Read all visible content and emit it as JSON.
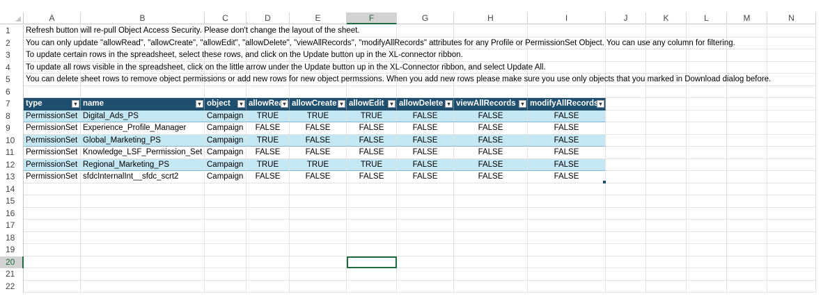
{
  "columns": [
    "A",
    "B",
    "C",
    "D",
    "E",
    "F",
    "G",
    "H",
    "I",
    "J",
    "K",
    "L",
    "M",
    "N"
  ],
  "row_numbers": [
    "1",
    "2",
    "3",
    "4",
    "5",
    "6",
    "7",
    "8",
    "9",
    "10",
    "11",
    "12",
    "13",
    "14",
    "15",
    "16",
    "17",
    "18",
    "19",
    "20",
    "21",
    "22"
  ],
  "selected_cell": "F20",
  "notes": [
    "Refresh button will re-pull Object Access Security. Please don't change the layout of the sheet.",
    "You can only update \"allowRead\", \"allowCreate\", \"allowEdit\", \"allowDelete\", \"viewAllRecords\", \"modifyAllRecords\" attributes for any Profile or PermissionSet Object. You can use any column for filtering.",
    "To update certain rows in the spreadsheet, select these rows, and click on the Update button up in the XL-connector ribbon.",
    "To update all rows visible in the spreadsheet, click on the little arrow under the Update button up in the XL-Connector ribbon, and select Update All.",
    "You can delete sheet rows to remove object permissions or add new rows for new object permssions. When you add new rows please make sure you use only objects that you marked in Download dialog before."
  ],
  "table": {
    "headers": [
      "type",
      "name",
      "object",
      "allowRead",
      "allowCreate",
      "allowEdit",
      "allowDelete",
      "viewAllRecords",
      "modifyAllRecords"
    ],
    "rows": [
      [
        "PermissionSet",
        "Digital_Ads_PS",
        "Campaign",
        "TRUE",
        "TRUE",
        "TRUE",
        "FALSE",
        "FALSE",
        "FALSE"
      ],
      [
        "PermissionSet",
        "Experience_Profile_Manager",
        "Campaign",
        "FALSE",
        "FALSE",
        "FALSE",
        "FALSE",
        "FALSE",
        "FALSE"
      ],
      [
        "PermissionSet",
        "Global_Marketing_PS",
        "Campaign",
        "TRUE",
        "FALSE",
        "FALSE",
        "FALSE",
        "FALSE",
        "FALSE"
      ],
      [
        "PermissionSet",
        "Knowledge_LSF_Permission_Set",
        "Campaign",
        "FALSE",
        "FALSE",
        "FALSE",
        "FALSE",
        "FALSE",
        "FALSE"
      ],
      [
        "PermissionSet",
        "Regional_Marketing_PS",
        "Campaign",
        "TRUE",
        "TRUE",
        "TRUE",
        "FALSE",
        "FALSE",
        "FALSE"
      ],
      [
        "PermissionSet",
        "sfdcInternalInt__sfdc_scrt2",
        "Campaign",
        "FALSE",
        "FALSE",
        "FALSE",
        "FALSE",
        "FALSE",
        "FALSE"
      ]
    ]
  },
  "icons": {
    "filter_dropdown": "chevron-down-icon",
    "select_all": "select-all-icon"
  },
  "colors": {
    "header_bg": "#1f4e6e",
    "band_bg": "#c5e6f3",
    "selection": "#1e6b3c"
  }
}
